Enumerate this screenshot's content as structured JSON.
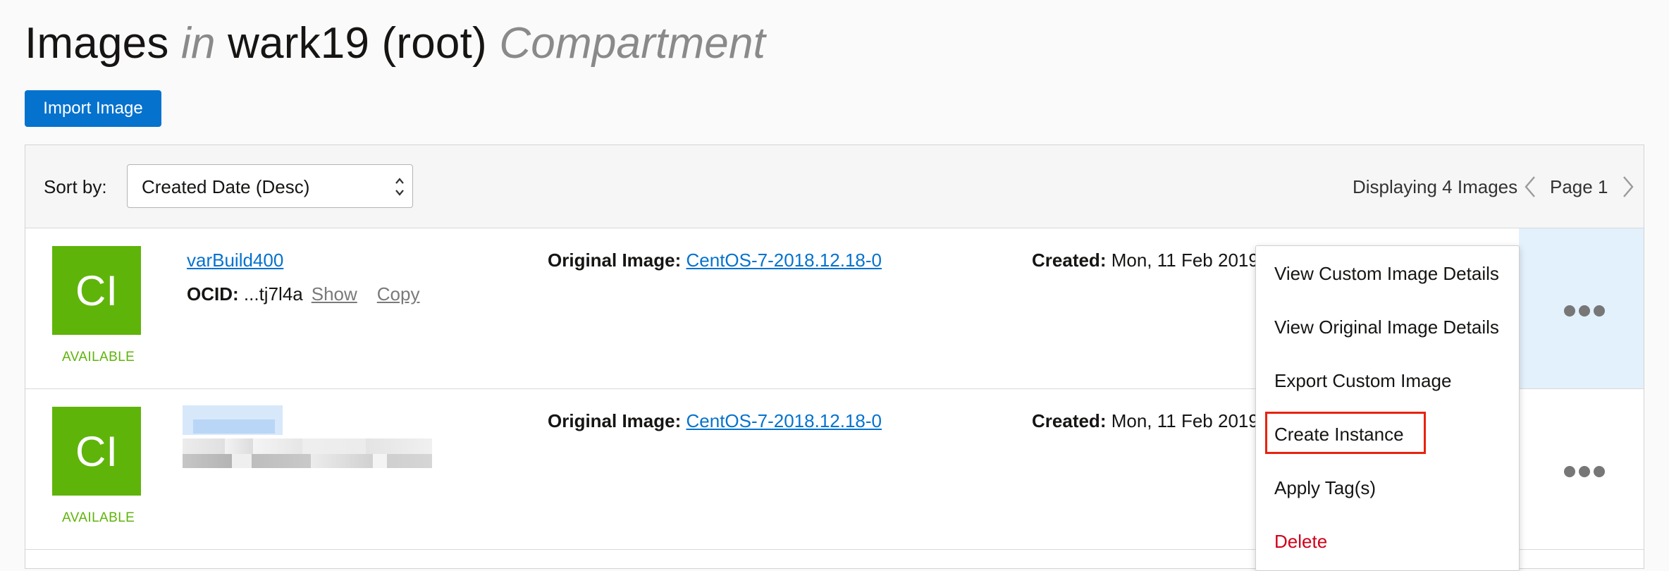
{
  "header": {
    "title_main": "Images",
    "title_in": "in",
    "title_compartment": "wark19 (root)",
    "title_suffix": "Compartment"
  },
  "toolbar": {
    "import_label": "Import Image",
    "sort_label": "Sort by:",
    "sort_value": "Created Date (Desc)",
    "displaying": "Displaying 4 Images",
    "page_label": "Page 1"
  },
  "rows": [
    {
      "tile": "CI",
      "status": "AVAILABLE",
      "name": "varBuild400",
      "ocid_label": "OCID:",
      "ocid_value": "...tj7l4a",
      "show_label": "Show",
      "copy_label": "Copy",
      "orig_label": "Original Image:",
      "orig_value": "CentOS-7-2018.12.18-0",
      "created_label": "Created:",
      "created_value": "Mon, 11 Feb 2019"
    },
    {
      "tile": "CI",
      "status": "AVAILABLE",
      "orig_label": "Original Image:",
      "orig_value": "CentOS-7-2018.12.18-0",
      "created_label": "Created:",
      "created_value": "Mon, 11 Feb 2019"
    }
  ],
  "menu": {
    "items": [
      "View Custom Image Details",
      "View Original Image Details",
      "Export Custom Image",
      "Create Instance",
      "Apply Tag(s)",
      "Delete"
    ]
  },
  "icons": {
    "sort": "up-down-chevron-icon",
    "prev": "chevron-left-icon",
    "next": "chevron-right-icon",
    "more": "more-horizontal-icon"
  },
  "colors": {
    "primary": "#0572ce",
    "available": "#5fb40a",
    "danger": "#d0021b",
    "highlight": "#e8220f"
  }
}
